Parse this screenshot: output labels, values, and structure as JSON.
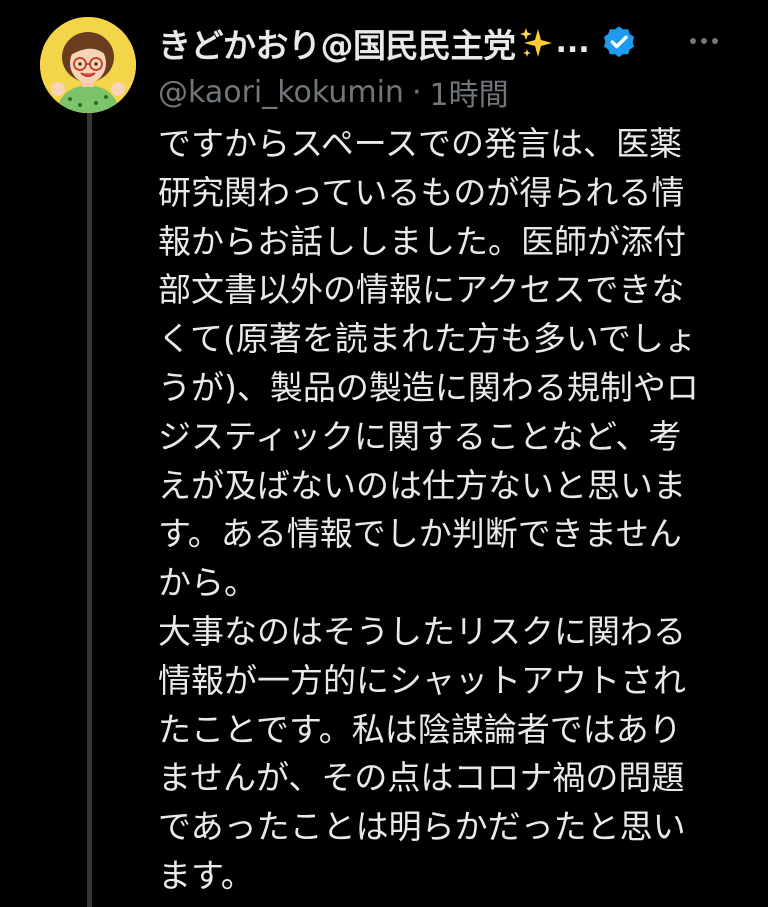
{
  "tweet": {
    "author": {
      "display_name": "きどかおり@国民民主党",
      "name_emoji": "sparkles-emoji",
      "truncation": "...",
      "handle": "@kaori_kokumin",
      "separator": "·",
      "timestamp": "1時間",
      "verified_icon": "verified-badge-icon",
      "avatar": "avatar-illustration"
    },
    "menu_icon": "more-horizontal-icon",
    "text_lines": [
      "ですからスペースでの発言は、医薬",
      "研究関わっているものが得られる情",
      "報からお話ししました。医師が添付",
      "部文書以外の情報にアクセスできな",
      "くて(原著を読まれた方も多いでしょ",
      "うが)、製品の製造に関わる規制やロ",
      "ジスティックに関することなど、考",
      "えが及ばないのは仕方ないと思いま",
      "す。ある情報でしか判断できません",
      "から。",
      "大事なのはそうしたリスクに関わる",
      "情報が一方的にシャットアウトされ",
      "たことです。私は陰謀論者ではあり",
      "ませんが、その点はコロナ禍の問題",
      "であったことは明らかだったと思い",
      "ます。"
    ]
  },
  "colors": {
    "background": "#000000",
    "text_primary": "#e7e9ea",
    "text_secondary": "#71767b",
    "verified_blue": "#1d9bf0",
    "thread_line": "#333639",
    "avatar_bg": "#f4d54a"
  }
}
